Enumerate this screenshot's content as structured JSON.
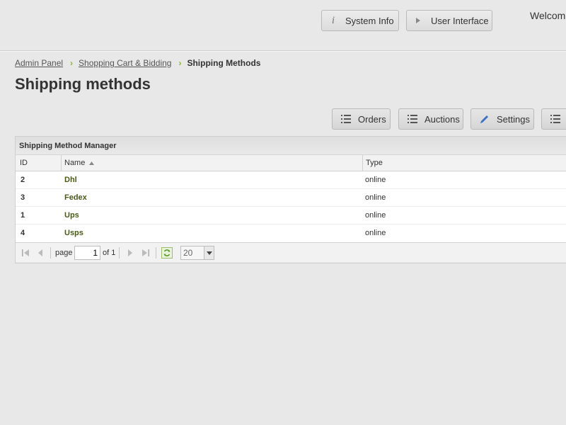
{
  "header": {
    "system_info_label": "System Info",
    "user_interface_label": "User Interface",
    "welcome_text": "Welcom"
  },
  "breadcrumb": {
    "items": [
      "Admin Panel",
      "Shopping Cart & Bidding"
    ],
    "current": "Shipping Methods"
  },
  "page": {
    "title": "Shipping methods"
  },
  "actions": {
    "orders_label": "Orders",
    "auctions_label": "Auctions",
    "settings_label": "Settings"
  },
  "grid": {
    "title": "Shipping Method Manager",
    "columns": [
      "ID",
      "Name",
      "Type"
    ],
    "sort_column": "Name",
    "sort_direction": "asc",
    "rows": [
      {
        "id": "2",
        "name": "Dhl",
        "type": "online"
      },
      {
        "id": "3",
        "name": "Fedex",
        "type": "online"
      },
      {
        "id": "1",
        "name": "Ups",
        "type": "online"
      },
      {
        "id": "4",
        "name": "Usps",
        "type": "online"
      }
    ]
  },
  "pager": {
    "page_label": "page",
    "page_value": "1",
    "of_label": "of 1",
    "page_size": "20"
  },
  "colors": {
    "background": "#e8e8e8",
    "name_link": "#4a5a1a",
    "breadcrumb_separator": "#8bb530",
    "edit_icon": "#3a6fc4",
    "refresh_icon": "#5a9a2a"
  }
}
